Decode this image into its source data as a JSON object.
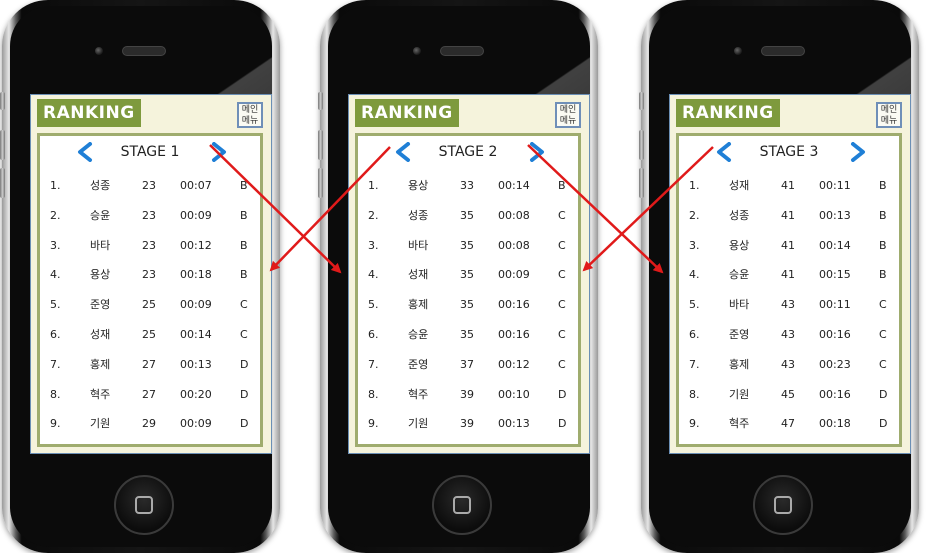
{
  "phones": [
    {
      "header": "RANKING",
      "menu": "메인\n메뉴",
      "stage": "STAGE 1",
      "rows": [
        {
          "rank": "1.",
          "name": "성종",
          "score": "23",
          "time": "00:07",
          "grade": "B"
        },
        {
          "rank": "2.",
          "name": "승윤",
          "score": "23",
          "time": "00:09",
          "grade": "B"
        },
        {
          "rank": "3.",
          "name": "바타",
          "score": "23",
          "time": "00:12",
          "grade": "B"
        },
        {
          "rank": "4.",
          "name": "용상",
          "score": "23",
          "time": "00:18",
          "grade": "B"
        },
        {
          "rank": "5.",
          "name": "준영",
          "score": "25",
          "time": "00:09",
          "grade": "C"
        },
        {
          "rank": "6.",
          "name": "성재",
          "score": "25",
          "time": "00:14",
          "grade": "C"
        },
        {
          "rank": "7.",
          "name": "홍제",
          "score": "27",
          "time": "00:13",
          "grade": "D"
        },
        {
          "rank": "8.",
          "name": "혁주",
          "score": "27",
          "time": "00:20",
          "grade": "D"
        },
        {
          "rank": "9.",
          "name": "기원",
          "score": "29",
          "time": "00:09",
          "grade": "D"
        }
      ]
    },
    {
      "header": "RANKING",
      "menu": "메인\n메뉴",
      "stage": "STAGE 2",
      "rows": [
        {
          "rank": "1.",
          "name": "용상",
          "score": "33",
          "time": "00:14",
          "grade": "B"
        },
        {
          "rank": "2.",
          "name": "성종",
          "score": "35",
          "time": "00:08",
          "grade": "C"
        },
        {
          "rank": "3.",
          "name": "바타",
          "score": "35",
          "time": "00:08",
          "grade": "C"
        },
        {
          "rank": "4.",
          "name": "성재",
          "score": "35",
          "time": "00:09",
          "grade": "C"
        },
        {
          "rank": "5.",
          "name": "홍제",
          "score": "35",
          "time": "00:16",
          "grade": "C"
        },
        {
          "rank": "6.",
          "name": "승윤",
          "score": "35",
          "time": "00:16",
          "grade": "C"
        },
        {
          "rank": "7.",
          "name": "준영",
          "score": "37",
          "time": "00:12",
          "grade": "C"
        },
        {
          "rank": "8.",
          "name": "혁주",
          "score": "39",
          "time": "00:10",
          "grade": "D"
        },
        {
          "rank": "9.",
          "name": "기원",
          "score": "39",
          "time": "00:13",
          "grade": "D"
        }
      ]
    },
    {
      "header": "RANKING",
      "menu": "메인\n메뉴",
      "stage": "STAGE 3",
      "rows": [
        {
          "rank": "1.",
          "name": "성재",
          "score": "41",
          "time": "00:11",
          "grade": "B"
        },
        {
          "rank": "2.",
          "name": "성종",
          "score": "41",
          "time": "00:13",
          "grade": "B"
        },
        {
          "rank": "3.",
          "name": "용상",
          "score": "41",
          "time": "00:14",
          "grade": "B"
        },
        {
          "rank": "4.",
          "name": "승윤",
          "score": "41",
          "time": "00:15",
          "grade": "B"
        },
        {
          "rank": "5.",
          "name": "바타",
          "score": "43",
          "time": "00:11",
          "grade": "C"
        },
        {
          "rank": "6.",
          "name": "준영",
          "score": "43",
          "time": "00:16",
          "grade": "C"
        },
        {
          "rank": "7.",
          "name": "홍제",
          "score": "43",
          "time": "00:23",
          "grade": "C"
        },
        {
          "rank": "8.",
          "name": "기원",
          "score": "45",
          "time": "00:16",
          "grade": "D"
        },
        {
          "rank": "9.",
          "name": "혁주",
          "score": "47",
          "time": "00:18",
          "grade": "D"
        }
      ]
    }
  ],
  "colors": {
    "header_bg": "#7e9a3d",
    "screen_bg": "#f5f3dc",
    "panel_border": "#9fac6e",
    "arrow_blue": "#1f7fd6",
    "link_red": "#e01a1a"
  },
  "icons": {
    "prev": "chevron-left-icon",
    "next": "chevron-right-icon",
    "home": "home-button-icon"
  }
}
